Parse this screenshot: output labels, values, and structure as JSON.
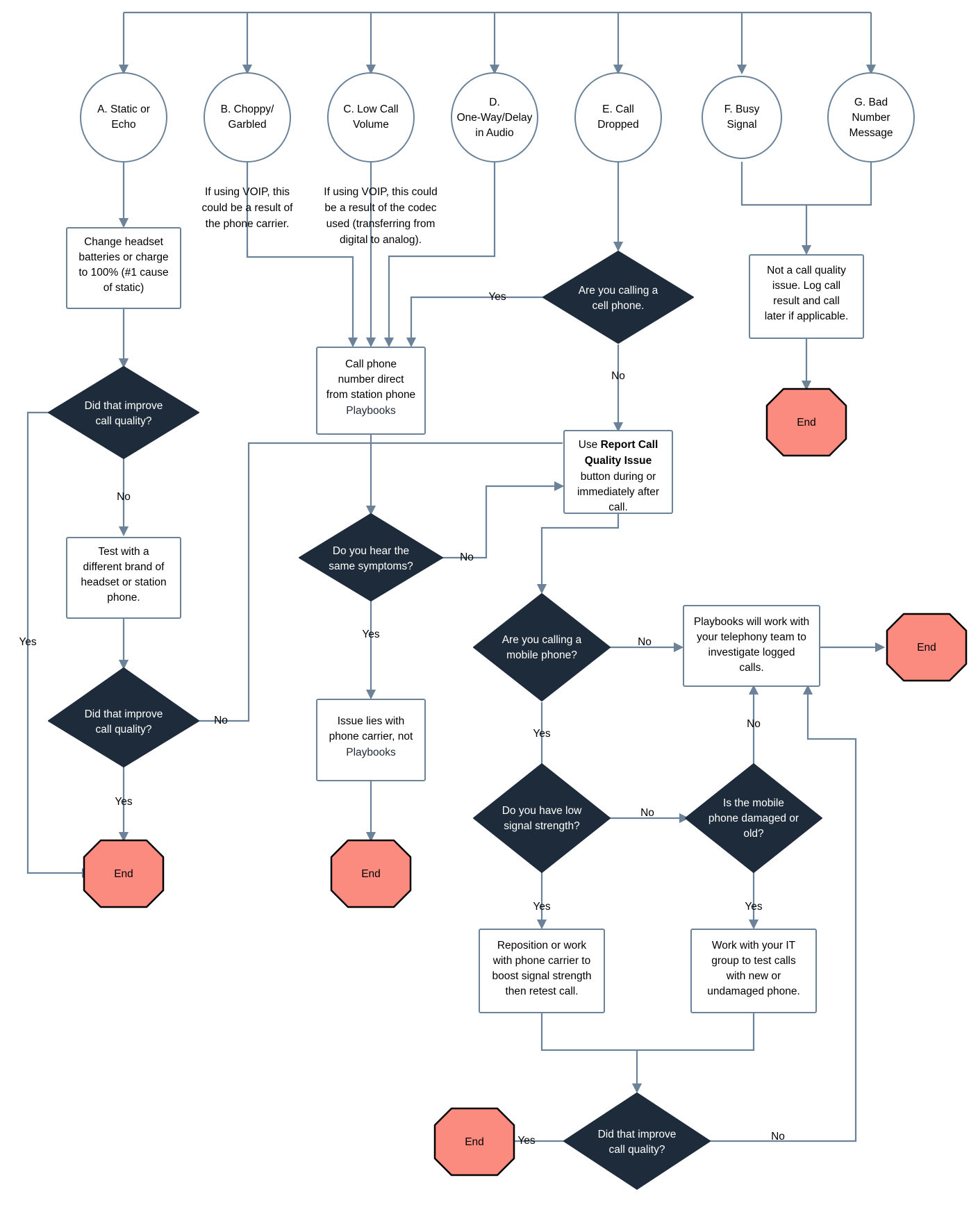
{
  "chart_data": {
    "type": "diagram",
    "diagram_type": "flowchart",
    "title": "Call Quality Troubleshooting Flowchart",
    "colors": {
      "decision_fill": "#1d2b3a",
      "decision_text": "#ffffff",
      "process_fill": "#ffffff",
      "process_stroke": "#6b8299",
      "terminator_fill": "#fb8b7e",
      "terminator_stroke": "#000000",
      "connector": "#6b8299",
      "text": "#000000"
    },
    "nodes": [
      {
        "id": "A",
        "shape": "circle",
        "label": "A. Static or Echo"
      },
      {
        "id": "B",
        "shape": "circle",
        "label": "B. Choppy/ Garbled"
      },
      {
        "id": "C",
        "shape": "circle",
        "label": "C. Low Call Volume"
      },
      {
        "id": "D",
        "shape": "circle",
        "label": "D. One-Way/Delay in Audio"
      },
      {
        "id": "E",
        "shape": "circle",
        "label": "E. Call Dropped"
      },
      {
        "id": "F",
        "shape": "circle",
        "label": "F. Busy Signal"
      },
      {
        "id": "G",
        "shape": "circle",
        "label": "G. Bad Number Message"
      },
      {
        "id": "note_b",
        "shape": "note",
        "label": "If using VOIP, this could be a result of the phone carrier."
      },
      {
        "id": "note_c",
        "shape": "note",
        "label": "If using VOIP, this could be a result of the codec used (transferring from digital to analog)."
      },
      {
        "id": "p_headset",
        "shape": "process",
        "label": "Change headset batteries or charge to 100% (#1 cause of static)"
      },
      {
        "id": "d_improve1",
        "shape": "decision",
        "label": "Did that improve call quality?"
      },
      {
        "id": "p_testbrand",
        "shape": "process",
        "label": "Test with a different brand of headset or station phone."
      },
      {
        "id": "d_improve2",
        "shape": "decision",
        "label": "Did that improve call quality?"
      },
      {
        "id": "end_left",
        "shape": "terminator",
        "label": "End"
      },
      {
        "id": "p_calldirect",
        "shape": "process",
        "label": "Call phone number direct from station phone",
        "sublabel": "Playbooks"
      },
      {
        "id": "d_symptoms",
        "shape": "decision",
        "label": "Do you hear the same symptoms?"
      },
      {
        "id": "p_carrier",
        "shape": "process",
        "label": "Issue lies with phone carrier, not",
        "sublabel": "Playbooks"
      },
      {
        "id": "end_center",
        "shape": "terminator",
        "label": "End"
      },
      {
        "id": "d_cellphone",
        "shape": "decision",
        "label": "Are you calling a cell phone."
      },
      {
        "id": "p_notquality",
        "shape": "process",
        "label": "Not a call quality issue. Log call result and call later if applicable."
      },
      {
        "id": "end_right_top",
        "shape": "terminator",
        "label": "End"
      },
      {
        "id": "p_reportbtn",
        "shape": "process",
        "label_parts": [
          {
            "text": "Use ",
            "bold": false
          },
          {
            "text": "Report Call Quality Issue",
            "bold": true
          },
          {
            "text": " button during or immediately after call.",
            "bold": false
          }
        ],
        "label": "Use Report Call Quality Issue button during or immediately after call."
      },
      {
        "id": "d_mobile",
        "shape": "decision",
        "label": "Are you calling a mobile phone?"
      },
      {
        "id": "p_telephony",
        "shape": "process",
        "label": "Playbooks will work with your telephony team to investigate logged calls."
      },
      {
        "id": "end_far_right",
        "shape": "terminator",
        "label": "End"
      },
      {
        "id": "d_signal",
        "shape": "decision",
        "label": "Do you have low signal strength?"
      },
      {
        "id": "d_damaged",
        "shape": "decision",
        "label": "Is the mobile phone damaged or old?"
      },
      {
        "id": "p_reposition",
        "shape": "process",
        "label": "Reposition or work with phone carrier to boost signal strength then retest call."
      },
      {
        "id": "p_itgroup",
        "shape": "process",
        "label": "Work with your IT group to test calls with new or undamaged phone."
      },
      {
        "id": "d_improve3",
        "shape": "decision",
        "label": "Did that improve call quality?"
      },
      {
        "id": "end_bottom",
        "shape": "terminator",
        "label": "End"
      }
    ],
    "edges": [
      {
        "from": "A",
        "to": "p_headset",
        "label": ""
      },
      {
        "from": "B",
        "to": "p_calldirect",
        "label": ""
      },
      {
        "from": "C",
        "to": "p_calldirect",
        "label": ""
      },
      {
        "from": "D",
        "to": "p_calldirect",
        "label": ""
      },
      {
        "from": "E",
        "to": "d_cellphone",
        "label": ""
      },
      {
        "from": "F",
        "to": "p_notquality",
        "label": ""
      },
      {
        "from": "G",
        "to": "p_notquality",
        "label": ""
      },
      {
        "from": "p_headset",
        "to": "d_improve1",
        "label": ""
      },
      {
        "from": "d_improve1",
        "to": "p_testbrand",
        "label": "No"
      },
      {
        "from": "d_improve1",
        "to": "end_left",
        "label": "Yes"
      },
      {
        "from": "p_testbrand",
        "to": "d_improve2",
        "label": ""
      },
      {
        "from": "d_improve2",
        "to": "end_left",
        "label": "Yes"
      },
      {
        "from": "d_improve2",
        "to": "p_reportbtn",
        "label": "No"
      },
      {
        "from": "p_calldirect",
        "to": "d_symptoms",
        "label": ""
      },
      {
        "from": "d_symptoms",
        "to": "p_carrier",
        "label": "Yes"
      },
      {
        "from": "d_symptoms",
        "to": "p_reportbtn",
        "label": "No"
      },
      {
        "from": "p_carrier",
        "to": "end_center",
        "label": ""
      },
      {
        "from": "d_cellphone",
        "to": "p_calldirect",
        "label": "Yes"
      },
      {
        "from": "d_cellphone",
        "to": "p_reportbtn",
        "label": "No"
      },
      {
        "from": "p_notquality",
        "to": "end_right_top",
        "label": ""
      },
      {
        "from": "p_reportbtn",
        "to": "d_mobile",
        "label": ""
      },
      {
        "from": "d_mobile",
        "to": "p_telephony",
        "label": "No"
      },
      {
        "from": "d_mobile",
        "to": "d_signal",
        "label": "Yes"
      },
      {
        "from": "p_telephony",
        "to": "end_far_right",
        "label": ""
      },
      {
        "from": "d_signal",
        "to": "d_damaged",
        "label": "No"
      },
      {
        "from": "d_signal",
        "to": "p_reposition",
        "label": "Yes"
      },
      {
        "from": "d_damaged",
        "to": "p_telephony",
        "label": "No"
      },
      {
        "from": "d_damaged",
        "to": "p_itgroup",
        "label": "Yes"
      },
      {
        "from": "p_reposition",
        "to": "d_improve3",
        "label": ""
      },
      {
        "from": "p_itgroup",
        "to": "d_improve3",
        "label": ""
      },
      {
        "from": "d_improve3",
        "to": "end_bottom",
        "label": "Yes"
      },
      {
        "from": "d_improve3",
        "to": "p_telephony",
        "label": "No"
      }
    ]
  },
  "nodes": {
    "a": {
      "l1": "A. Static or",
      "l2": "Echo"
    },
    "b": {
      "l1": "B. Choppy/",
      "l2": "Garbled"
    },
    "c": {
      "l1": "C. Low Call",
      "l2": "Volume"
    },
    "d": {
      "l1": "D.",
      "l2": "One-Way/Delay",
      "l3": "in Audio"
    },
    "e": {
      "l1": "E. Call",
      "l2": "Dropped"
    },
    "f": {
      "l1": "F. Busy",
      "l2": "Signal"
    },
    "g": {
      "l1": "G. Bad",
      "l2": "Number",
      "l3": "Message"
    },
    "note_b": {
      "l1": "If using VOIP, this",
      "l2": "could be a result of",
      "l3": "the phone carrier."
    },
    "note_c": {
      "l1": "If using VOIP, this could",
      "l2": "be a result of the codec",
      "l3": "used (transferring from",
      "l4": "digital to analog)."
    },
    "headset": {
      "l1": "Change headset",
      "l2": "batteries or charge",
      "l3": "to 100% (#1 cause",
      "l4": "of static)"
    },
    "improve1": {
      "l1": "Did that improve",
      "l2": "call quality?"
    },
    "testbrand": {
      "l1": "Test with a",
      "l2": "different brand of",
      "l3": "headset or station",
      "l4": "phone."
    },
    "improve2": {
      "l1": "Did that improve",
      "l2": "call quality?"
    },
    "calldirect": {
      "l1": "Call phone",
      "l2": "number direct",
      "l3": "from station phone",
      "l4": "Playbooks"
    },
    "symptoms": {
      "l1": "Do you hear the",
      "l2": "same symptoms?"
    },
    "carrier": {
      "l1": "Issue lies with",
      "l2": "phone carrier, not",
      "l3": "Playbooks"
    },
    "cellphone": {
      "l1": "Are you calling a",
      "l2": "cell phone."
    },
    "notquality": {
      "l1": "Not a call quality",
      "l2": "issue. Log call",
      "l3": "result and call",
      "l4": "later if applicable."
    },
    "reportbtn": {
      "l1a": "Use ",
      "l1b": "Report Call",
      "l2": "Quality Issue",
      "l3": "button during or",
      "l4": "immediately after",
      "l5": "call."
    },
    "mobile": {
      "l1": "Are you calling a",
      "l2": "mobile phone?"
    },
    "telephony": {
      "l1": "Playbooks will work with",
      "l2": "your telephony team to",
      "l3": "investigate logged",
      "l4": "calls."
    },
    "signal": {
      "l1": "Do you have low",
      "l2": "signal strength?"
    },
    "damaged": {
      "l1": "Is the mobile",
      "l2": "phone damaged or",
      "l3": "old?"
    },
    "reposition": {
      "l1": "Reposition or work",
      "l2": "with phone carrier to",
      "l3": "boost signal strength",
      "l4": "then retest call."
    },
    "itgroup": {
      "l1": "Work with your IT",
      "l2": "group to test calls",
      "l3": "with new or",
      "l4": "undamaged phone."
    },
    "improve3": {
      "l1": "Did that improve",
      "l2": "call quality?"
    },
    "end": {
      "label": "End"
    }
  },
  "edge_labels": {
    "yes": "Yes",
    "no": "No",
    "improve1_no": "No",
    "improve1_yes": "Yes",
    "improve2_no": "No",
    "improve2_yes": "Yes",
    "symptoms_yes": "Yes",
    "symptoms_no": "No",
    "cellphone_yes": "Yes",
    "cellphone_no": "No",
    "mobile_no": "No",
    "mobile_yes": "Yes",
    "signal_no": "No",
    "signal_yes": "Yes",
    "damaged_no": "No",
    "damaged_yes": "Yes",
    "improve3_yes": "Yes",
    "improve3_no": "No"
  }
}
